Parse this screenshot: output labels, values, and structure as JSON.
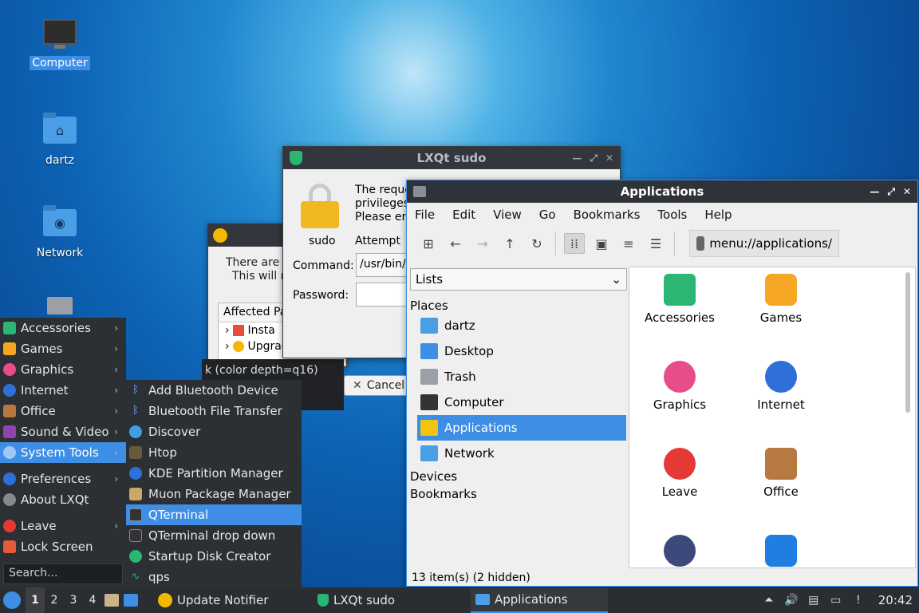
{
  "desktop": {
    "icons": [
      {
        "label": "Computer"
      },
      {
        "label": "dartz"
      },
      {
        "label": "Network"
      }
    ]
  },
  "update_notifier": {
    "line1": "There are u",
    "line2": "This will r",
    "affected_header": "Affected Pa",
    "row1": "Insta",
    "row2": "Upgrade"
  },
  "terminal_fragment": {
    "text": "k (color depth=q16)",
    "cancel_label": "Cancel"
  },
  "sudo": {
    "title": "LXQt sudo",
    "icon_label": "sudo",
    "msg1": "The reque",
    "msg2": "privileges",
    "msg3": "Please en",
    "attempt": "Attempt",
    "command_label": "Command:",
    "command_value": "/usr/bin/",
    "password_label": "Password:"
  },
  "apps": {
    "title": "Applications",
    "menu": [
      "File",
      "Edit",
      "View",
      "Go",
      "Bookmarks",
      "Tools",
      "Help"
    ],
    "address": "menu://applications/",
    "side_combo": "Lists",
    "places_header": "Places",
    "places": [
      {
        "label": "dartz",
        "color": "#4a9ee6"
      },
      {
        "label": "Desktop",
        "color": "#3d8ee4"
      },
      {
        "label": "Trash",
        "color": "#9aa0a6"
      },
      {
        "label": "Computer",
        "color": "#333333"
      },
      {
        "label": "Applications",
        "color": "#f1c40f"
      },
      {
        "label": "Network",
        "color": "#4a9ee6"
      }
    ],
    "devices_header": "Devices",
    "bookmarks_header": "Bookmarks",
    "grid": [
      {
        "label": "Accessories",
        "color": "#2bb673"
      },
      {
        "label": "Games",
        "color": "#f5a623"
      },
      {
        "label": "Graphics",
        "color": "#e84c8b"
      },
      {
        "label": "Internet",
        "color": "#2f6fd8"
      },
      {
        "label": "Leave",
        "color": "#e53935"
      },
      {
        "label": "Office",
        "color": "#b7793f"
      },
      {
        "label": "",
        "color": "#3b4a7a"
      },
      {
        "label": "",
        "color": "#1e7fe0"
      }
    ],
    "status": "13 item(s) (2 hidden)"
  },
  "main_menu": {
    "items": [
      {
        "label": "Accessories",
        "color": "#2bb673",
        "sub": true
      },
      {
        "label": "Games",
        "color": "#f5a623",
        "sub": true
      },
      {
        "label": "Graphics",
        "color": "#e84c8b",
        "sub": true
      },
      {
        "label": "Internet",
        "color": "#2f6fd8",
        "sub": true
      },
      {
        "label": "Office",
        "color": "#b7793f",
        "sub": true
      },
      {
        "label": "Sound & Video",
        "color": "#8e44ad",
        "sub": true
      },
      {
        "label": "System Tools",
        "color": "#3d8ee4",
        "sub": true
      },
      {
        "label": "Preferences",
        "color": "#2f6fd8",
        "sub": true
      },
      {
        "label": "About LXQt",
        "color": "#888888",
        "sub": false
      },
      {
        "label": "Leave",
        "color": "#e53935",
        "sub": true
      },
      {
        "label": "Lock Screen",
        "color": "#e55a3a",
        "sub": false
      }
    ],
    "search_placeholder": "Search..."
  },
  "submenu": {
    "items": [
      {
        "label": "Add Bluetooth Device",
        "color": "#2f6fd8"
      },
      {
        "label": "Bluetooth File Transfer",
        "color": "#2f6fd8"
      },
      {
        "label": "Discover",
        "color": "#3da0e4"
      },
      {
        "label": "Htop",
        "color": "#6b5a3a"
      },
      {
        "label": "KDE Partition Manager",
        "color": "#2f6fd8"
      },
      {
        "label": "Muon Package Manager",
        "color": "#c9a86a"
      },
      {
        "label": "QTerminal",
        "color": "#333333"
      },
      {
        "label": "QTerminal drop down",
        "color": "#333333"
      },
      {
        "label": "Startup Disk Creator",
        "color": "#2bb673"
      },
      {
        "label": "qps",
        "color": "#2bb673"
      }
    ]
  },
  "taskbar": {
    "desktops": [
      "1",
      "2",
      "3",
      "4"
    ],
    "tasks": [
      {
        "label": "Update Notifier"
      },
      {
        "label": "LXQt sudo"
      },
      {
        "label": "Applications"
      }
    ],
    "clock": "20:42"
  }
}
